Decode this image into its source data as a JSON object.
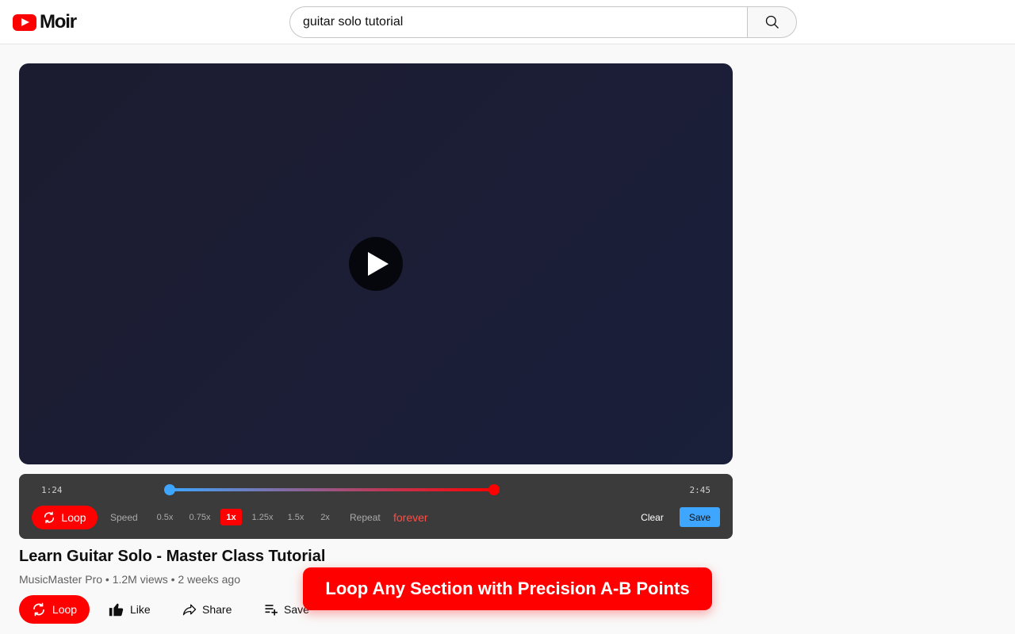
{
  "app": {
    "logo_text": "Moir"
  },
  "search": {
    "value": "guitar solo tutorial"
  },
  "loop_bar": {
    "start_time": "1:24",
    "end_time": "2:45",
    "loop_label": "Loop",
    "speed_label": "Speed",
    "speeds": [
      "0.5x",
      "0.75x",
      "1x",
      "1.25x",
      "1.5x",
      "2x"
    ],
    "active_speed": "1x",
    "repeat_label": "Repeat",
    "repeat_value": "forever",
    "clear_label": "Clear",
    "save_label": "Save",
    "accent_a": "#3ea6ff",
    "accent_b": "#ff0000"
  },
  "video": {
    "title": "Learn Guitar Solo - Master Class Tutorial",
    "meta": "MusicMaster Pro • 1.2M views • 2 weeks ago"
  },
  "actions": {
    "loop": "Loop",
    "like": "Like",
    "share": "Share",
    "save": "Save"
  },
  "banner": {
    "text": "Loop Any Section with Precision A-B Points"
  },
  "icons": {
    "search": "search-icon",
    "play": "play-icon",
    "loop": "loop-icon",
    "like": "thumbs-up-icon",
    "share": "share-arrow-icon",
    "save": "playlist-add-icon"
  }
}
